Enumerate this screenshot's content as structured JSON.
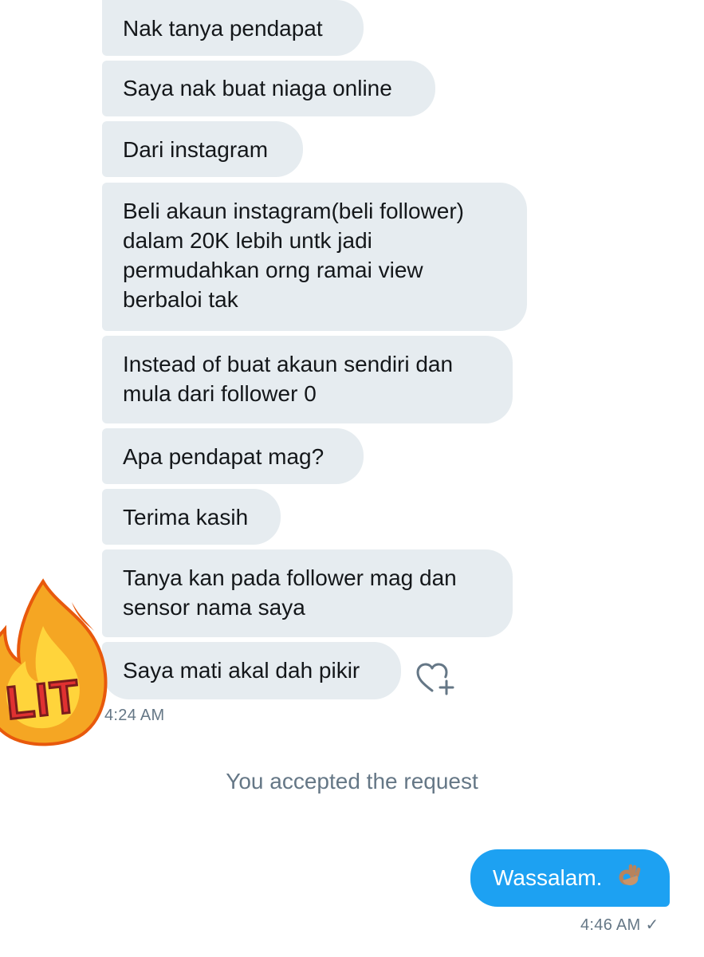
{
  "conversation": {
    "incoming_messages": [
      {
        "text": "Nak tanya pendapat"
      },
      {
        "text": "Saya nak buat niaga online"
      },
      {
        "text": "Dari instagram"
      },
      {
        "text": "Beli akaun instagram(beli follower) dalam 20K lebih untk jadi permudahkan orng ramai view berbaloi tak"
      },
      {
        "text": "Instead of buat akaun sendiri dan mula dari follower 0"
      },
      {
        "text": "Apa pendapat mag?"
      },
      {
        "text": "Terima kasih"
      },
      {
        "text": "Tanya kan pada follower mag dan sensor nama saya"
      },
      {
        "text": "Saya mati akal dah pikir"
      }
    ],
    "incoming_timestamp": "4:24 AM",
    "system_note": "You accepted the request",
    "outgoing_message": {
      "text": "Wassalam.",
      "emoji": "ok-hand-emoji"
    },
    "outgoing_timestamp": "4:46 AM",
    "sticker": {
      "icon": "fire-emoji",
      "label": "LIT"
    },
    "reaction_icon": "heart-plus-icon"
  },
  "colors": {
    "incoming_bubble": "#e6ecf0",
    "outgoing_bubble": "#1da1f2",
    "meta_text": "#657786",
    "body_text": "#14171a"
  }
}
